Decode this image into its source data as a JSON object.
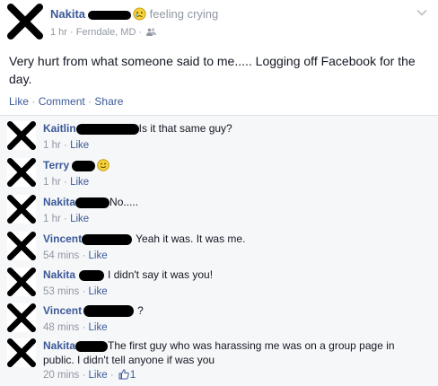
{
  "post": {
    "author": "Nakita",
    "feeling_text": "feeling crying",
    "time": "1 hr",
    "location": "Ferndale, MD",
    "separator": "·",
    "body": "Very hurt from what someone said to me..... Logging off Facebook for the day.",
    "actions": {
      "like": "Like",
      "comment": "Comment",
      "share": "Share",
      "separator": "·"
    }
  },
  "comments": [
    {
      "author": "Kaitlin",
      "text": "Is it that same guy?",
      "time": "1 hr",
      "like": "Like"
    },
    {
      "author": "Terry",
      "text": "",
      "time": "1 hr",
      "like": "Like"
    },
    {
      "author": "Nakita",
      "text": "No.....",
      "time": "1 hr",
      "like": "Like"
    },
    {
      "author": "Vincent",
      "text": "Yeah it was. It was me.",
      "time": "54 mins",
      "like": "Like"
    },
    {
      "author": "Nakita",
      "text": "I didn't say it was you!",
      "time": "53 mins",
      "like": "Like"
    },
    {
      "author": "Vincent",
      "text": "?",
      "time": "48 mins",
      "like": "Like"
    },
    {
      "author": "Nakita",
      "text": "The first guy who was harassing me was on a group page in public. I didn't tell anyone if was you",
      "time": "20 mins",
      "like": "Like",
      "like_count": "1"
    }
  ],
  "meta_separator": "·",
  "colors": {
    "link": "#3b5998",
    "meta": "#9197a3",
    "comment_bg": "#f6f7f8",
    "redaction": "#000000"
  },
  "icons": [
    "crying-emoji-icon",
    "audience-friends-icon",
    "chevron-down-icon",
    "smile-emoji-icon",
    "thumbs-up-icon",
    "redacted-avatar-x-icon"
  ]
}
